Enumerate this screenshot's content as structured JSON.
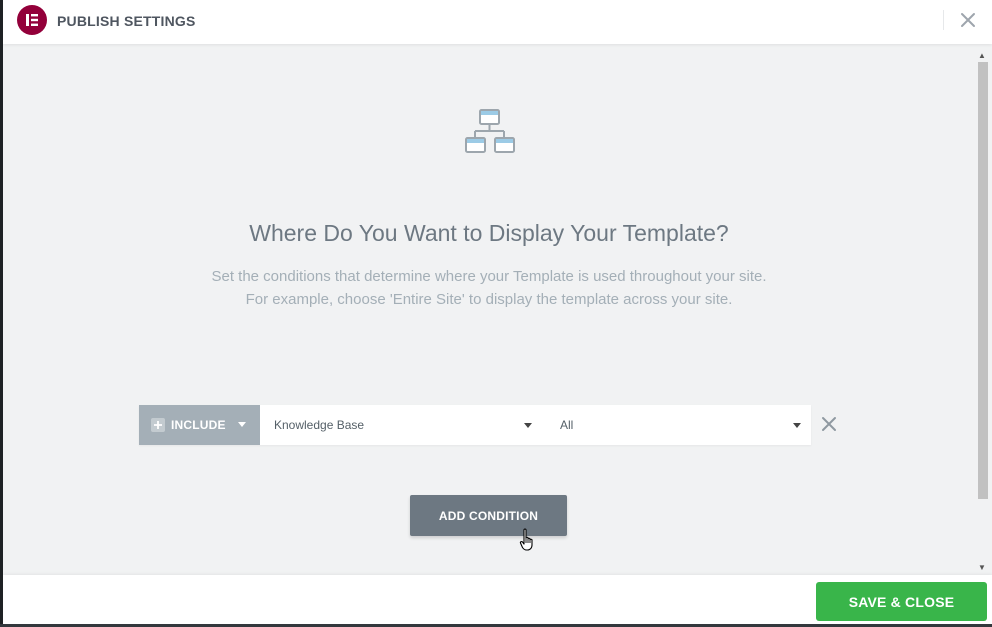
{
  "header": {
    "title": "PUBLISH SETTINGS",
    "logo_icon": "elementor-logo-icon",
    "close_icon": "close-icon",
    "logo_color": "#93003a"
  },
  "content": {
    "illustration_icon": "sitemap-icon",
    "heading": "Where Do You Want to Display Your Template?",
    "description_line1": "Set the conditions that determine where your Template is used throughout your site.",
    "description_line2": "For example, choose 'Entire Site' to display the template across your site."
  },
  "condition": {
    "type_label": "INCLUDE",
    "main_value": "Knowledge Base",
    "sub_value": "All"
  },
  "actions": {
    "add_condition_label": "ADD CONDITION",
    "save_close_label": "SAVE & CLOSE",
    "save_color": "#39b54a",
    "add_color": "#6d7882"
  }
}
